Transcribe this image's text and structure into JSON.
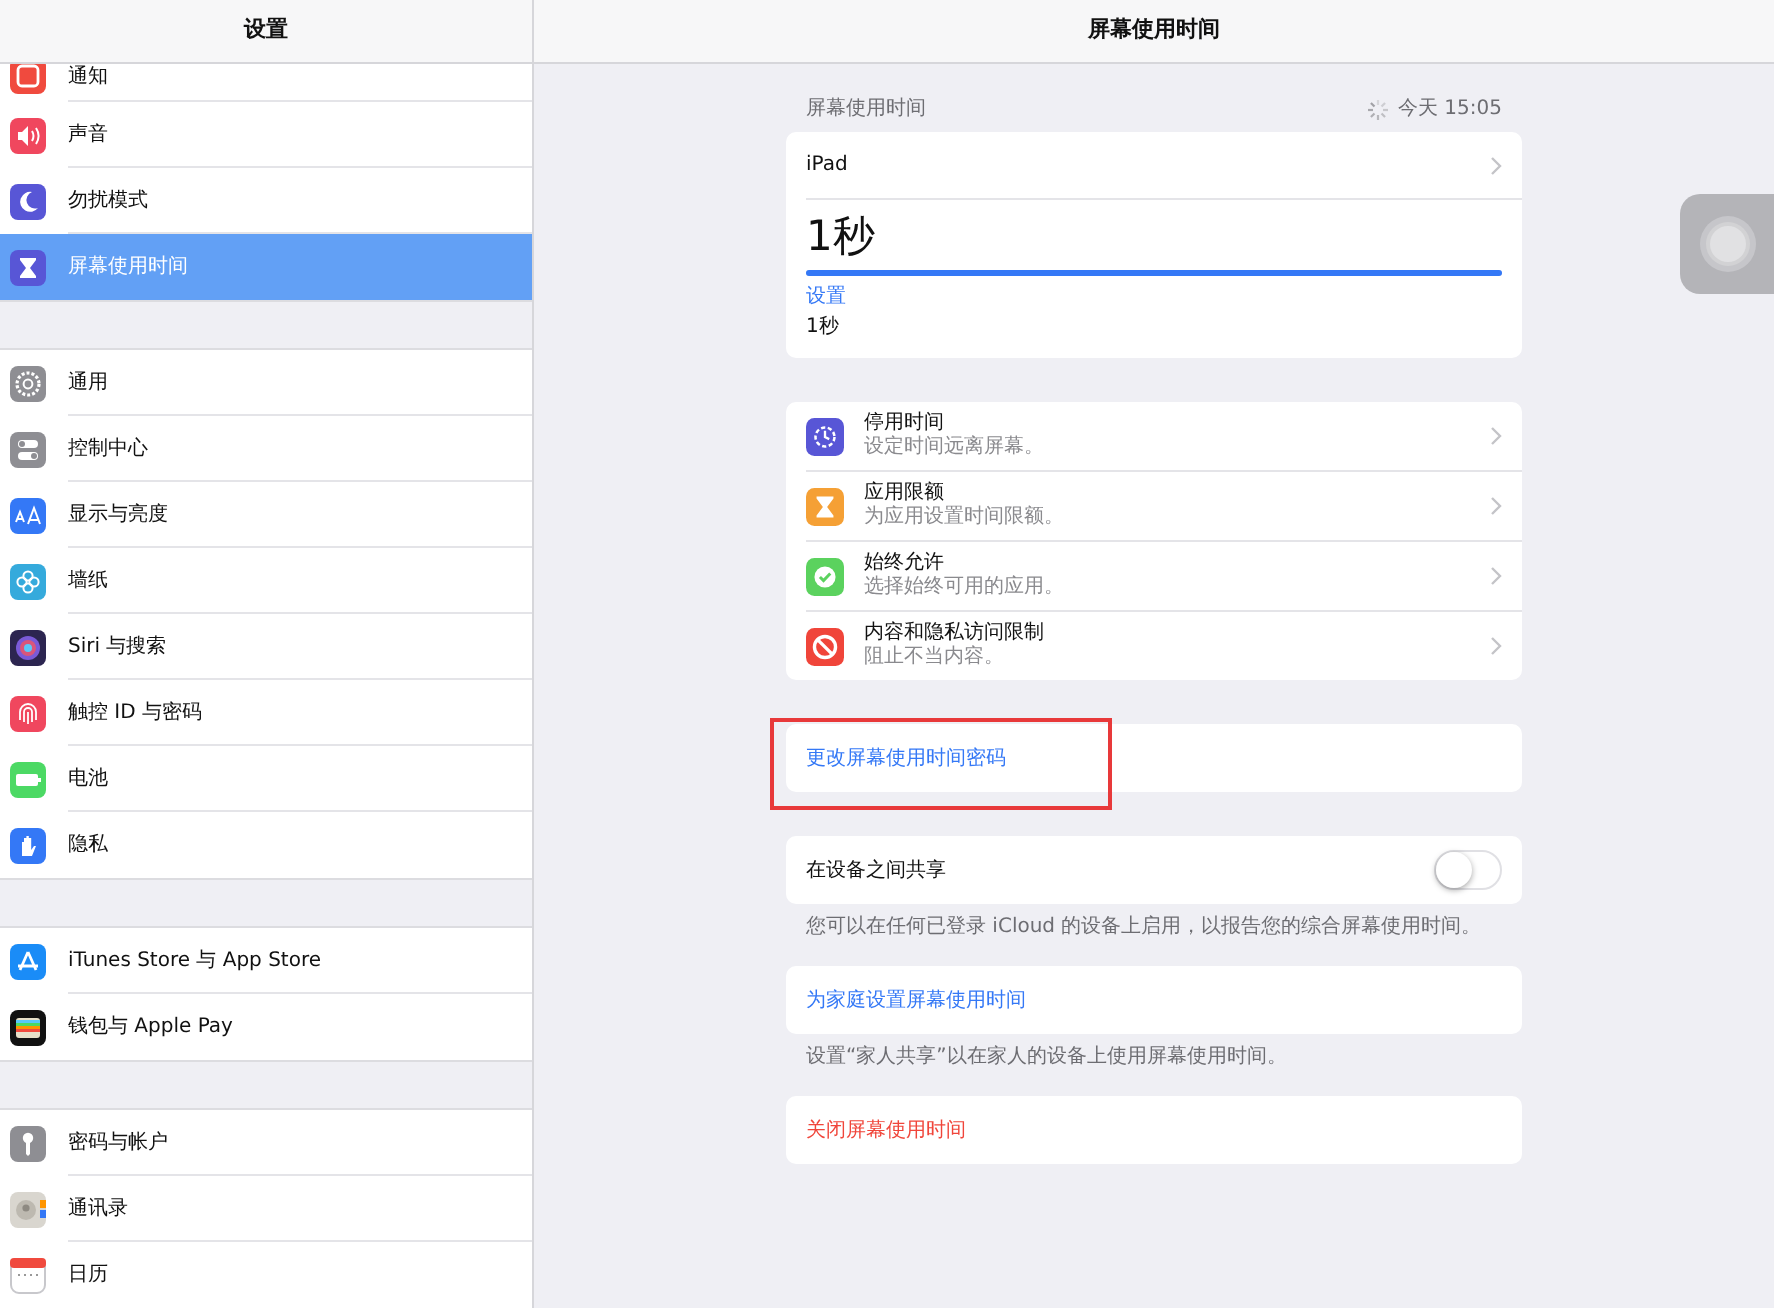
{
  "sidebar": {
    "title": "设置",
    "groups": [
      [
        {
          "label": "通知",
          "selected": false
        },
        {
          "label": "声音",
          "selected": false
        },
        {
          "label": "勿扰模式",
          "selected": false
        },
        {
          "label": "屏幕使用时间",
          "selected": true
        }
      ],
      [
        {
          "label": "通用",
          "selected": false
        },
        {
          "label": "控制中心",
          "selected": false
        },
        {
          "label": "显示与亮度",
          "selected": false
        },
        {
          "label": "墙纸",
          "selected": false
        },
        {
          "label": "Siri 与搜索",
          "selected": false
        },
        {
          "label": "触控 ID 与密码",
          "selected": false
        },
        {
          "label": "电池",
          "selected": false
        },
        {
          "label": "隐私",
          "selected": false
        }
      ],
      [
        {
          "label": "iTunes Store 与 App Store",
          "selected": false
        },
        {
          "label": "钱包与 Apple Pay",
          "selected": false
        }
      ],
      [
        {
          "label": "密码与帐户",
          "selected": false
        },
        {
          "label": "通讯录",
          "selected": false
        },
        {
          "label": "日历",
          "selected": false
        }
      ]
    ]
  },
  "main": {
    "title": "屏幕使用时间",
    "summary": {
      "header": "屏幕使用时间",
      "updated": "今天 15:05",
      "device": "iPad",
      "total": "1秒",
      "level": 1,
      "category": "设置",
      "category_time": "1秒"
    },
    "features": [
      {
        "title": "停用时间",
        "subtitle": "设定时间远离屏幕。"
      },
      {
        "title": "应用限额",
        "subtitle": "为应用设置时间限额。"
      },
      {
        "title": "始终允许",
        "subtitle": "选择始终可用的应用。"
      },
      {
        "title": "内容和隐私访问限制",
        "subtitle": "阻止不当内容。"
      }
    ],
    "passcode_link": {
      "label": "更改屏幕使用时间密码",
      "highlighted": true
    },
    "share": {
      "label": "在设备之间共享",
      "on": false,
      "footer": "您可以在任何已登录 iCloud 的设备上启用，以报告您的综合屏幕使用时间。"
    },
    "family_link": {
      "label": "为家庭设置屏幕使用时间",
      "footer": "设置“家人共享”以在家人的设备上使用屏幕使用时间。"
    },
    "turn_off": {
      "label": "关闭屏幕使用时间"
    }
  }
}
